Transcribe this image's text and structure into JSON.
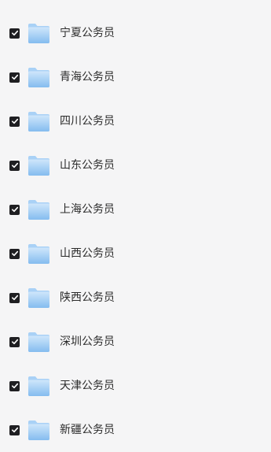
{
  "file_list": {
    "items": [
      {
        "name": "",
        "checked": true
      },
      {
        "name": "宁夏公务员",
        "checked": true
      },
      {
        "name": "青海公务员",
        "checked": true
      },
      {
        "name": "四川公务员",
        "checked": true
      },
      {
        "name": "山东公务员",
        "checked": true
      },
      {
        "name": "上海公务员",
        "checked": true
      },
      {
        "name": "山西公务员",
        "checked": true
      },
      {
        "name": "陕西公务员",
        "checked": true
      },
      {
        "name": "深圳公务员",
        "checked": true
      },
      {
        "name": "天津公务员",
        "checked": true
      },
      {
        "name": "新疆公务员",
        "checked": true
      }
    ],
    "checkbox_icon": "checkmark-icon",
    "folder_icon": "folder-icon"
  },
  "colors": {
    "background": "#f5f5f6",
    "checkbox": "#1f1f22",
    "folder_light": "#cfe6fb",
    "folder_dark": "#84bcef",
    "text": "#2b2b2b"
  }
}
